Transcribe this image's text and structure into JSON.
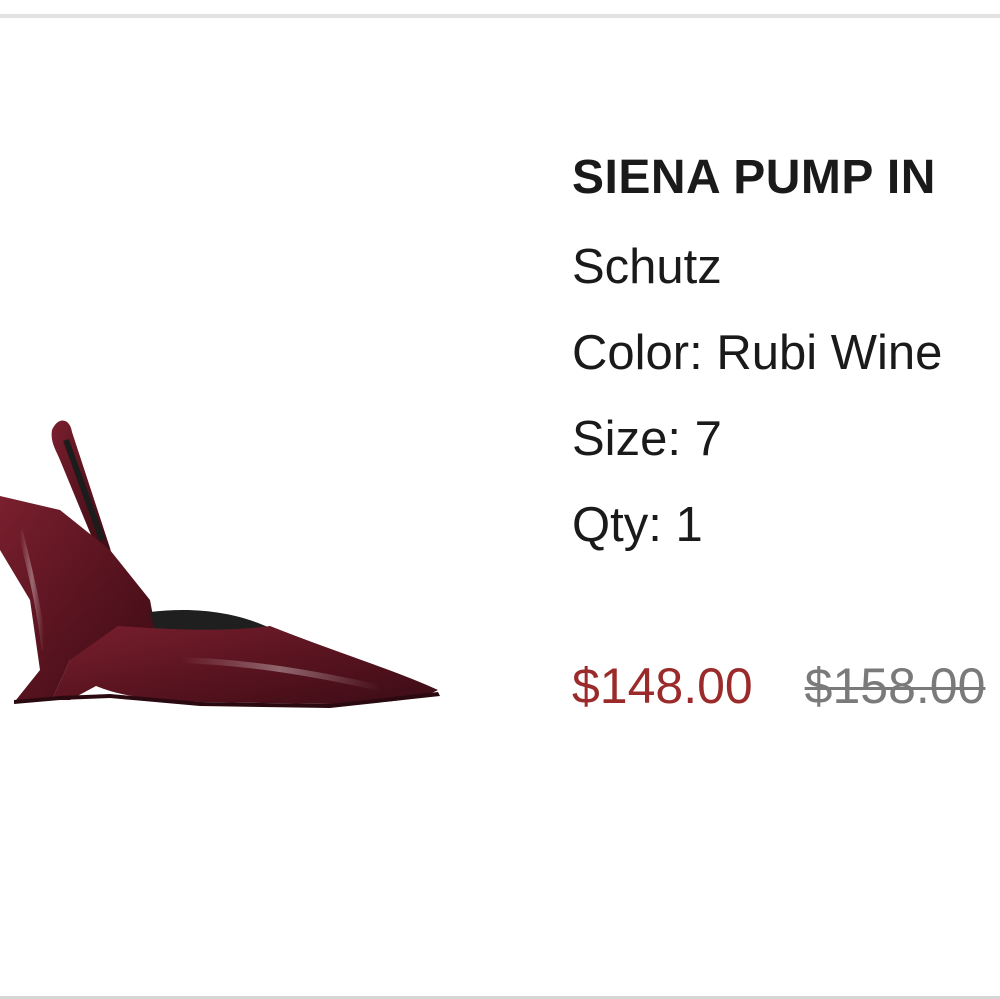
{
  "product": {
    "title": "SIENA PUMP IN",
    "brand": "Schutz",
    "color_label": "Color:",
    "color_value": "Rubi Wine",
    "size_label": "Size:",
    "size_value": "7",
    "qty_label": "Qty:",
    "qty_value": "1",
    "sale_price": "$148.00",
    "original_price": "$158.00",
    "image_icon": "shoe-image",
    "colors": {
      "sale": "#9b2b2b",
      "original": "#7a7a7a",
      "shoe": "#5a1420"
    }
  }
}
